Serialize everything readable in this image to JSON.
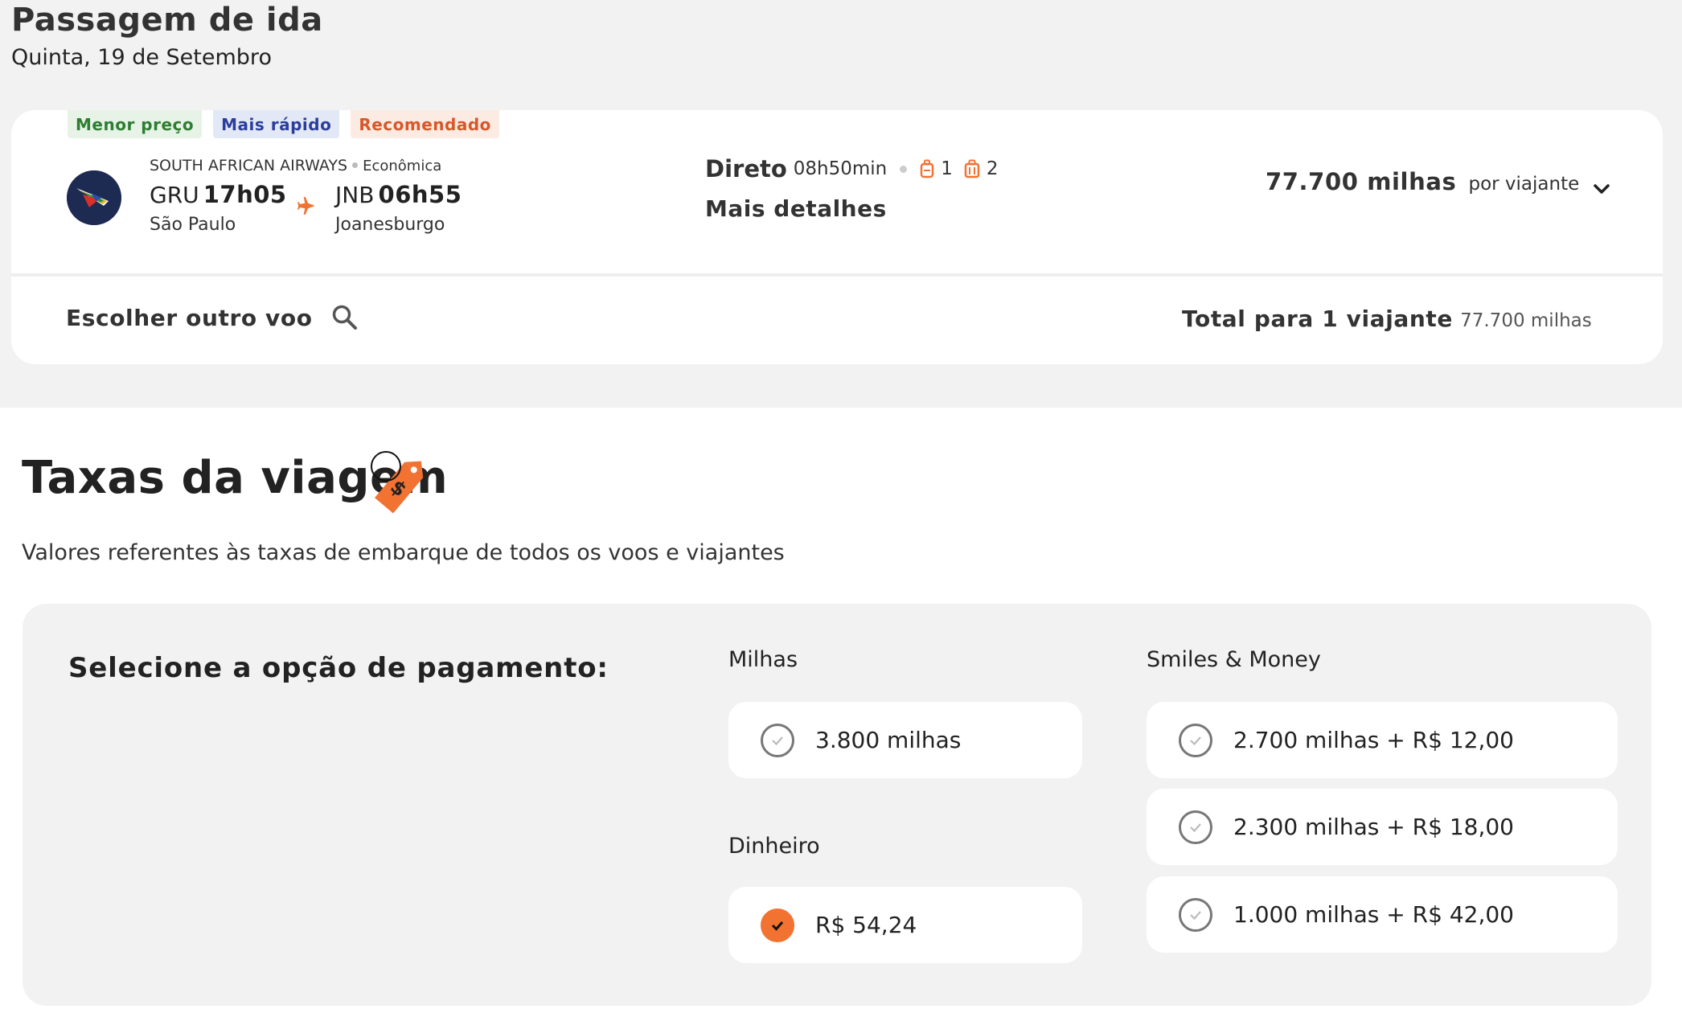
{
  "header": {
    "title": "Passagem de ida",
    "date": "Quinta, 19 de Setembro"
  },
  "flight": {
    "badges": [
      "Menor preço",
      "Mais rápido",
      "Recomendado"
    ],
    "airline": "SOUTH AFRICAN AIRWAYS",
    "cabin": "Econômica",
    "departure": {
      "code": "GRU",
      "time": "17h05",
      "city": "São Paulo"
    },
    "arrival": {
      "code": "JNB",
      "time": "06h55",
      "city": "Joanesburgo"
    },
    "stops": "Direto",
    "duration": "08h50min",
    "carry_on": "1",
    "checked_bags": "2",
    "details_link": "Mais detalhes",
    "price_miles": "77.700 milhas",
    "price_per": "por viajante",
    "choose_other": "Escolher outro voo",
    "total_label": "Total para 1 viajante",
    "total_value": "77.700 milhas"
  },
  "taxes": {
    "title": "Taxas da viagem",
    "description": "Valores referentes às taxas de embarque de todos os voos e viajantes",
    "payment_heading": "Selecione a opção de pagamento:",
    "miles_title": "Milhas",
    "miles_option": "3.800 milhas",
    "money_title": "Dinheiro",
    "money_option": "R$ 54,24",
    "smiles_title": "Smiles & Money",
    "smiles_options": [
      "2.700 milhas + R$ 12,00",
      "2.300 milhas + R$ 18,00",
      "1.000 milhas + R$ 42,00"
    ],
    "selected": "R$ 54,24"
  },
  "colors": {
    "accent": "#f27232",
    "background": "#f2f2f2"
  }
}
